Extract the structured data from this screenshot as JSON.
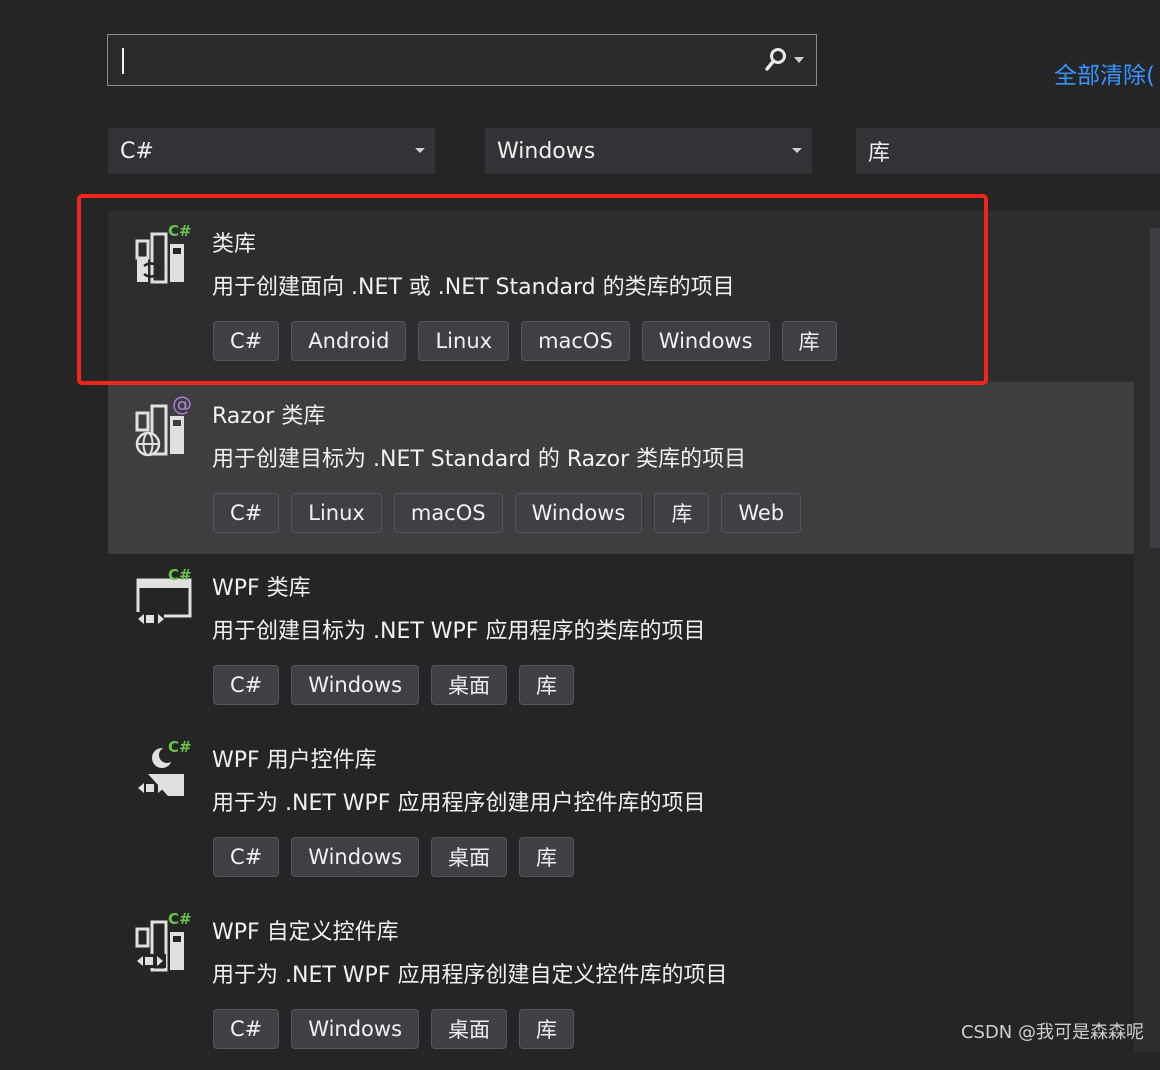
{
  "search": {
    "value": "",
    "placeholder": ""
  },
  "clear_all_label": "全部清除(",
  "filters": {
    "language": "C#",
    "platform": "Windows",
    "project_type": "库"
  },
  "templates": [
    {
      "title": "类库",
      "description": "用于创建面向 .NET 或 .NET Standard 的类库的项目",
      "badge": "C#",
      "icon": "class-library-icon",
      "tags": [
        "C#",
        "Android",
        "Linux",
        "macOS",
        "Windows",
        "库"
      ],
      "state": "selected"
    },
    {
      "title": "Razor 类库",
      "description": "用于创建目标为 .NET Standard 的 Razor 类库的项目",
      "badge": "@",
      "icon": "razor-class-library-icon",
      "tags": [
        "C#",
        "Linux",
        "macOS",
        "Windows",
        "库",
        "Web"
      ],
      "state": "hovered"
    },
    {
      "title": "WPF 类库",
      "description": "用于创建目标为 .NET WPF 应用程序的类库的项目",
      "badge": "C#",
      "icon": "wpf-class-library-icon",
      "tags": [
        "C#",
        "Windows",
        "桌面",
        "库"
      ],
      "state": "normal"
    },
    {
      "title": "WPF 用户控件库",
      "description": "用于为 .NET WPF 应用程序创建用户控件库的项目",
      "badge": "C#",
      "icon": "wpf-user-control-library-icon",
      "tags": [
        "C#",
        "Windows",
        "桌面",
        "库"
      ],
      "state": "normal"
    },
    {
      "title": "WPF 自定义控件库",
      "description": "用于为 .NET WPF 应用程序创建自定义控件库的项目",
      "badge": "C#",
      "icon": "wpf-custom-control-library-icon",
      "tags": [
        "C#",
        "Windows",
        "桌面",
        "库"
      ],
      "state": "normal"
    }
  ],
  "watermark": "CSDN @我可是森森呢",
  "colors": {
    "background": "#252526",
    "accent_link": "#3794ff",
    "highlight_border": "#f2251c",
    "badge_csharp": "#6cc24a",
    "badge_razor": "#b180d7"
  }
}
